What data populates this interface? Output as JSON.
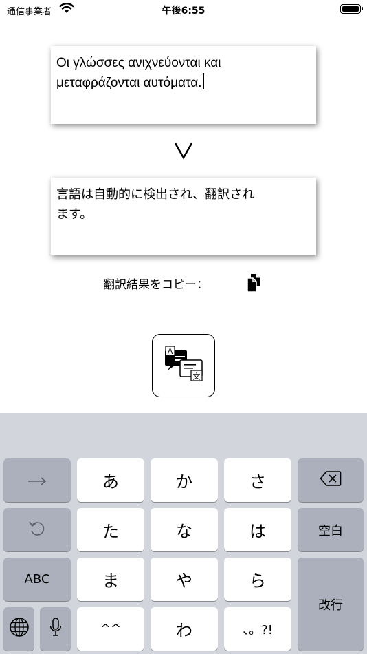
{
  "status_bar": {
    "carrier": "通信事業者",
    "time": "午後6:55"
  },
  "source_text": {
    "line1": "Οι γλώσσες ανιχνεύονται και",
    "line2": "μεταφράζονται αυτόματα."
  },
  "result_text": {
    "line1": "言語は自動的に検出され、翻訳され",
    "line2": "ます。"
  },
  "copy": {
    "label": "翻訳結果をコピー："
  },
  "icons": {
    "wifi": "wifi-icon",
    "battery": "battery-icon",
    "chevron": "chevron-down-icon",
    "copy": "copy-icon",
    "translate": "translate-icon",
    "next": "arrow-right-icon",
    "undo": "undo-icon",
    "delete": "delete-icon",
    "globe": "globe-icon",
    "mic": "microphone-icon"
  },
  "keyboard": {
    "row1": [
      "あ",
      "か",
      "さ"
    ],
    "row2": [
      "た",
      "な",
      "は"
    ],
    "row3": [
      "ま",
      "や",
      "ら"
    ],
    "row4": [
      "^^",
      "わ",
      "、。?!"
    ],
    "space_label": "空白",
    "abc_label": "ABC",
    "return_label": "改行"
  },
  "colors": {
    "keyboard_bg": "#d2d5db",
    "key_light": "#ffffff",
    "key_dark": "#abb0bc"
  }
}
